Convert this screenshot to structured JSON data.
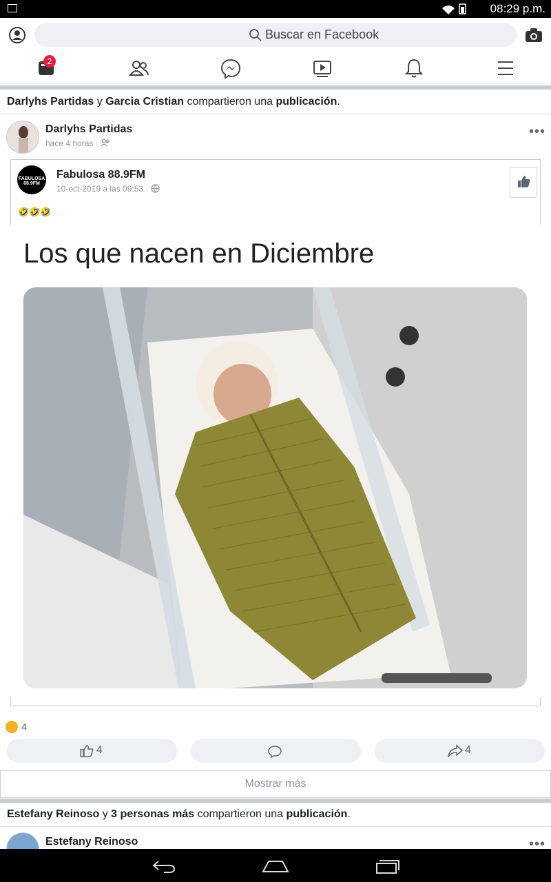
{
  "status": {
    "time": "08:29 p.m."
  },
  "search": {
    "placeholder": "Buscar en Facebook"
  },
  "tabs": {
    "news_badge": "2"
  },
  "post1": {
    "shared_names": [
      "Darlyhs Partidas",
      "Garcia Cristian"
    ],
    "shared_connector": "y",
    "shared_action": "compartieron una",
    "shared_object": "publicación",
    "author": "Darlyhs Partidas",
    "time": "hace 4 horas",
    "inner": {
      "page": "Fabulosa 88.9FM",
      "date": "10-oct-2019 a las 09:53",
      "logo_text": "FABULOSA 88.9FM",
      "text": "🤣🤣🤣",
      "meme_caption": "Los que nacen en Diciembre"
    },
    "reactions": "4",
    "like_count": "4",
    "share_count": "4",
    "show_more": "Mostrar más"
  },
  "post2": {
    "shared_name": "Estefany Reinoso",
    "shared_connector": "y",
    "shared_others": "3 personas más",
    "shared_action": "compartieron una",
    "shared_object": "publicación",
    "author": "Estefany Reinoso"
  }
}
